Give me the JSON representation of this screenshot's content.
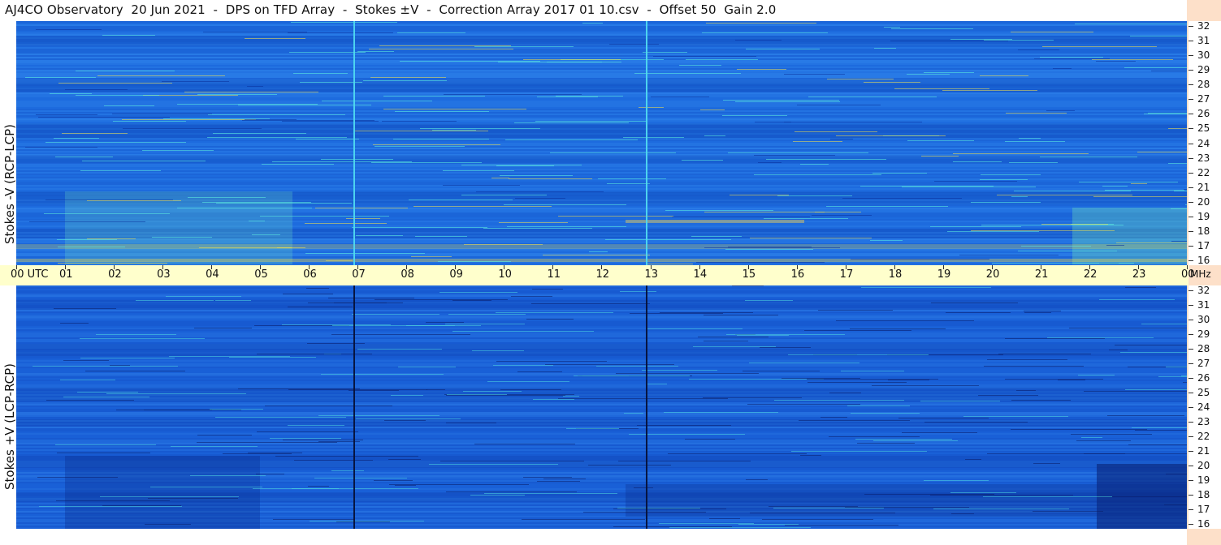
{
  "title": "AJ4CO Observatory  20 Jun 2021  -  DPS on TFD Array  -  Stokes ±V  -  Correction Array 2017 01 10.csv  -  Offset 50  Gain 2.0",
  "top_panel": {
    "label": "Stokes -V (RCP-LCP)"
  },
  "bottom_panel": {
    "label": "Stokes +V (LCP-RCP)"
  },
  "time_axis": {
    "labels": [
      "00  UTC",
      "01",
      "02",
      "03",
      "04",
      "05",
      "06",
      "07",
      "08",
      "09",
      "10",
      "11",
      "12",
      "13",
      "14",
      "15",
      "16",
      "17",
      "18",
      "19",
      "20",
      "21",
      "22",
      "23",
      "00"
    ]
  },
  "freq_axis": {
    "unit": "MHz",
    "labels": [
      "32",
      "31",
      "30",
      "29",
      "28",
      "27",
      "26",
      "25",
      "24",
      "23",
      "22",
      "21",
      "20",
      "19",
      "18",
      "17",
      "16"
    ]
  },
  "colors": {
    "axis_band": "#ffffcc",
    "right_strip": "#fde0c9",
    "spectro_top_base": "#1f6fe0",
    "spectro_bottom_base": "#1a5fd6"
  }
}
